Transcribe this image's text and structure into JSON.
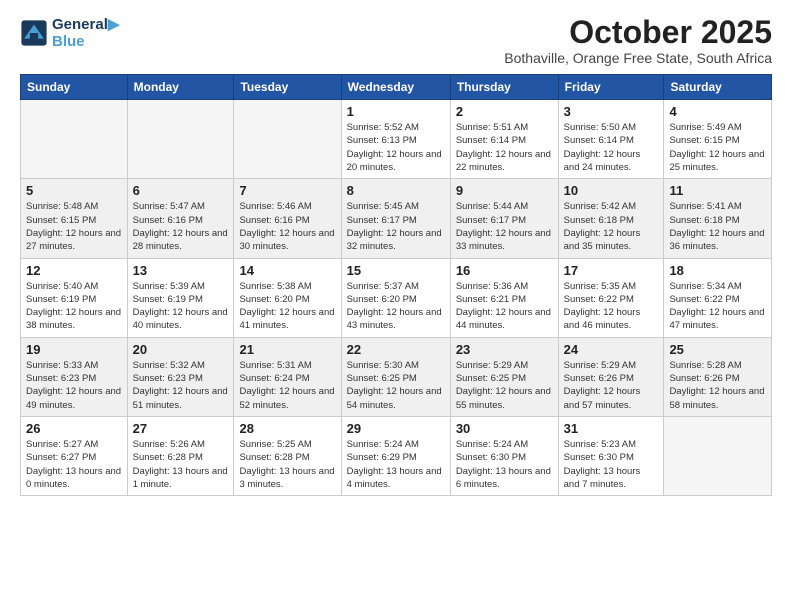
{
  "header": {
    "logo_line1": "General",
    "logo_line2": "Blue",
    "month": "October 2025",
    "location": "Bothaville, Orange Free State, South Africa"
  },
  "days_of_week": [
    "Sunday",
    "Monday",
    "Tuesday",
    "Wednesday",
    "Thursday",
    "Friday",
    "Saturday"
  ],
  "weeks": [
    {
      "shaded": false,
      "days": [
        {
          "num": "",
          "info": ""
        },
        {
          "num": "",
          "info": ""
        },
        {
          "num": "",
          "info": ""
        },
        {
          "num": "1",
          "info": "Sunrise: 5:52 AM\nSunset: 6:13 PM\nDaylight: 12 hours\nand 20 minutes."
        },
        {
          "num": "2",
          "info": "Sunrise: 5:51 AM\nSunset: 6:14 PM\nDaylight: 12 hours\nand 22 minutes."
        },
        {
          "num": "3",
          "info": "Sunrise: 5:50 AM\nSunset: 6:14 PM\nDaylight: 12 hours\nand 24 minutes."
        },
        {
          "num": "4",
          "info": "Sunrise: 5:49 AM\nSunset: 6:15 PM\nDaylight: 12 hours\nand 25 minutes."
        }
      ]
    },
    {
      "shaded": true,
      "days": [
        {
          "num": "5",
          "info": "Sunrise: 5:48 AM\nSunset: 6:15 PM\nDaylight: 12 hours\nand 27 minutes."
        },
        {
          "num": "6",
          "info": "Sunrise: 5:47 AM\nSunset: 6:16 PM\nDaylight: 12 hours\nand 28 minutes."
        },
        {
          "num": "7",
          "info": "Sunrise: 5:46 AM\nSunset: 6:16 PM\nDaylight: 12 hours\nand 30 minutes."
        },
        {
          "num": "8",
          "info": "Sunrise: 5:45 AM\nSunset: 6:17 PM\nDaylight: 12 hours\nand 32 minutes."
        },
        {
          "num": "9",
          "info": "Sunrise: 5:44 AM\nSunset: 6:17 PM\nDaylight: 12 hours\nand 33 minutes."
        },
        {
          "num": "10",
          "info": "Sunrise: 5:42 AM\nSunset: 6:18 PM\nDaylight: 12 hours\nand 35 minutes."
        },
        {
          "num": "11",
          "info": "Sunrise: 5:41 AM\nSunset: 6:18 PM\nDaylight: 12 hours\nand 36 minutes."
        }
      ]
    },
    {
      "shaded": false,
      "days": [
        {
          "num": "12",
          "info": "Sunrise: 5:40 AM\nSunset: 6:19 PM\nDaylight: 12 hours\nand 38 minutes."
        },
        {
          "num": "13",
          "info": "Sunrise: 5:39 AM\nSunset: 6:19 PM\nDaylight: 12 hours\nand 40 minutes."
        },
        {
          "num": "14",
          "info": "Sunrise: 5:38 AM\nSunset: 6:20 PM\nDaylight: 12 hours\nand 41 minutes."
        },
        {
          "num": "15",
          "info": "Sunrise: 5:37 AM\nSunset: 6:20 PM\nDaylight: 12 hours\nand 43 minutes."
        },
        {
          "num": "16",
          "info": "Sunrise: 5:36 AM\nSunset: 6:21 PM\nDaylight: 12 hours\nand 44 minutes."
        },
        {
          "num": "17",
          "info": "Sunrise: 5:35 AM\nSunset: 6:22 PM\nDaylight: 12 hours\nand 46 minutes."
        },
        {
          "num": "18",
          "info": "Sunrise: 5:34 AM\nSunset: 6:22 PM\nDaylight: 12 hours\nand 47 minutes."
        }
      ]
    },
    {
      "shaded": true,
      "days": [
        {
          "num": "19",
          "info": "Sunrise: 5:33 AM\nSunset: 6:23 PM\nDaylight: 12 hours\nand 49 minutes."
        },
        {
          "num": "20",
          "info": "Sunrise: 5:32 AM\nSunset: 6:23 PM\nDaylight: 12 hours\nand 51 minutes."
        },
        {
          "num": "21",
          "info": "Sunrise: 5:31 AM\nSunset: 6:24 PM\nDaylight: 12 hours\nand 52 minutes."
        },
        {
          "num": "22",
          "info": "Sunrise: 5:30 AM\nSunset: 6:25 PM\nDaylight: 12 hours\nand 54 minutes."
        },
        {
          "num": "23",
          "info": "Sunrise: 5:29 AM\nSunset: 6:25 PM\nDaylight: 12 hours\nand 55 minutes."
        },
        {
          "num": "24",
          "info": "Sunrise: 5:29 AM\nSunset: 6:26 PM\nDaylight: 12 hours\nand 57 minutes."
        },
        {
          "num": "25",
          "info": "Sunrise: 5:28 AM\nSunset: 6:26 PM\nDaylight: 12 hours\nand 58 minutes."
        }
      ]
    },
    {
      "shaded": false,
      "days": [
        {
          "num": "26",
          "info": "Sunrise: 5:27 AM\nSunset: 6:27 PM\nDaylight: 13 hours\nand 0 minutes."
        },
        {
          "num": "27",
          "info": "Sunrise: 5:26 AM\nSunset: 6:28 PM\nDaylight: 13 hours\nand 1 minute."
        },
        {
          "num": "28",
          "info": "Sunrise: 5:25 AM\nSunset: 6:28 PM\nDaylight: 13 hours\nand 3 minutes."
        },
        {
          "num": "29",
          "info": "Sunrise: 5:24 AM\nSunset: 6:29 PM\nDaylight: 13 hours\nand 4 minutes."
        },
        {
          "num": "30",
          "info": "Sunrise: 5:24 AM\nSunset: 6:30 PM\nDaylight: 13 hours\nand 6 minutes."
        },
        {
          "num": "31",
          "info": "Sunrise: 5:23 AM\nSunset: 6:30 PM\nDaylight: 13 hours\nand 7 minutes."
        },
        {
          "num": "",
          "info": ""
        }
      ]
    }
  ]
}
